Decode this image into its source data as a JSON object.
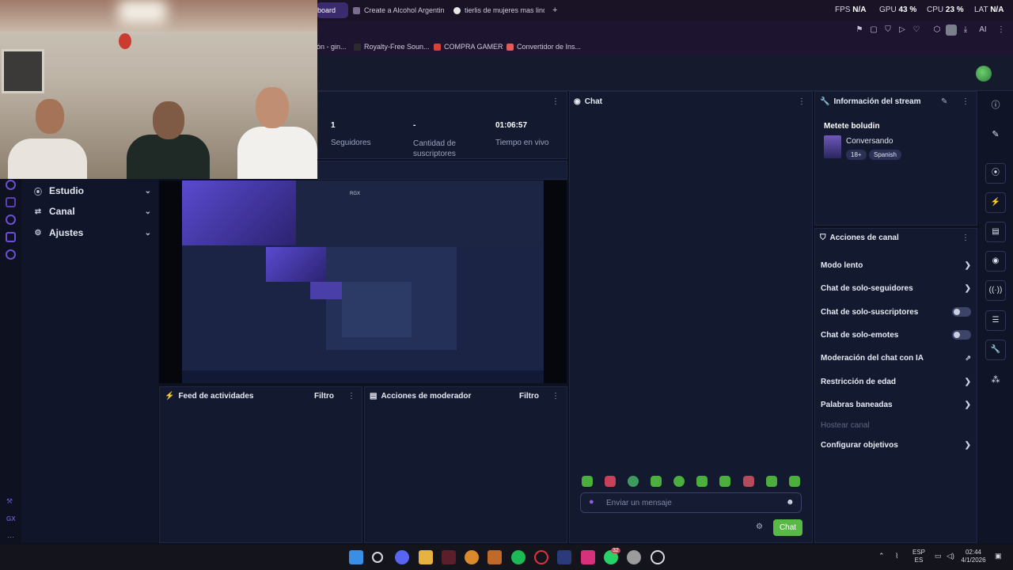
{
  "browser": {
    "active_tab": "board",
    "tabs": [
      "Create a Alcohol Argentin…",
      "tierlis de mujeres mas lind…"
    ],
    "new_tab": "+",
    "stats": [
      {
        "label": "FPS",
        "value": "N/A"
      },
      {
        "label": "GPU",
        "value": "43 %"
      },
      {
        "label": "CPU",
        "value": "23 %"
      },
      {
        "label": "LAT",
        "value": "N/A"
      }
    ],
    "ai_label": "AI",
    "bookmarks": [
      "ón - gin...",
      "Royalty-Free Soun...",
      "COMPRA GAMER",
      "Convertidor de Ins..."
    ]
  },
  "sidenav": {
    "items": [
      {
        "label": "Estudio",
        "icon": "studio-icon"
      },
      {
        "label": "Canal",
        "icon": "channel-icon"
      },
      {
        "label": "Ajustes",
        "icon": "settings-gear-icon"
      }
    ]
  },
  "stats_panel": {
    "followers": {
      "value": "1",
      "label": "Seguidores"
    },
    "subs": {
      "value": "-",
      "label": "Cantidad de suscriptores"
    },
    "live": {
      "value": "01:06:57",
      "label": "Tiempo en vivo"
    }
  },
  "preview": {
    "overlay_label": "RGX"
  },
  "activity": {
    "title": "Feed de actividades",
    "filter": "Filtro"
  },
  "modactions": {
    "title": "Acciones de moderador",
    "filter": "Filtro"
  },
  "chat": {
    "title": "Chat",
    "placeholder": "Enviar un mensaje",
    "send_label": "Chat"
  },
  "stream_info": {
    "header": "Información del stream",
    "title": "Metete boludin",
    "category": "Conversando",
    "tags": [
      "18+",
      "Spanish"
    ]
  },
  "channel_actions": {
    "header": "Acciones de canal",
    "items": [
      {
        "label": "Modo lento",
        "control": "chevron"
      },
      {
        "label": "Chat de solo-seguidores",
        "control": "chevron"
      },
      {
        "label": "Chat de solo-suscriptores",
        "control": "toggle"
      },
      {
        "label": "Chat de solo-emotes",
        "control": "toggle"
      },
      {
        "label": "Moderación del chat con IA",
        "control": "external"
      },
      {
        "label": "Restricción de edad",
        "control": "chevron"
      },
      {
        "label": "Palabras baneadas",
        "control": "chevron"
      },
      {
        "label": "Hostear canal",
        "control": "disabled"
      },
      {
        "label": "Configurar objetivos",
        "control": "chevron"
      }
    ]
  },
  "taskbar": {
    "lang": "ESP",
    "lang2": "ES",
    "time": "02:44",
    "date": "4/1/2026",
    "whatsapp_badge": "32"
  },
  "rail_text": "GX",
  "colors": {
    "accent": "#58b947",
    "brand": "#6a4fd0"
  }
}
